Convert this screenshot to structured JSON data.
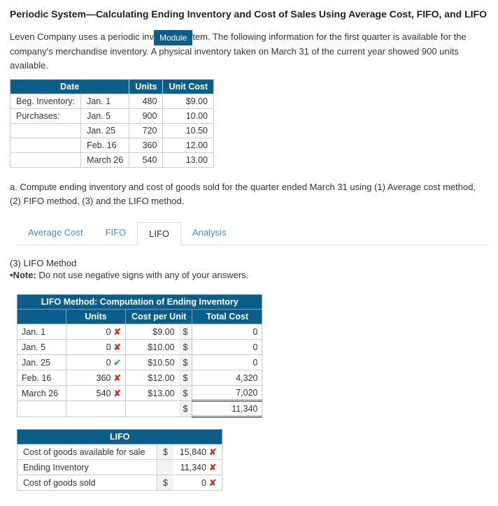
{
  "title": "Periodic System—Calculating Ending Inventory and Cost of Sales Using Average Cost, FIFO, and LIFO",
  "intro_before": "Leven Company uses a periodic inv",
  "module_label": "Module",
  "intro_after": "tem. The following information for the first quarter is available for the company's merchandise inventory. A physical inventory taken on March 31 of the current year showed 900 units available.",
  "inv_table": {
    "headers": {
      "date": "Date",
      "units": "Units",
      "unit_cost": "Unit Cost"
    },
    "rows": [
      {
        "label": "Beg. Inventory:",
        "date": "Jan. 1",
        "units": "480",
        "cost": "$9.00"
      },
      {
        "label": "Purchases:",
        "date": "Jan. 5",
        "units": "900",
        "cost": "10.00"
      },
      {
        "label": "",
        "date": "Jan. 25",
        "units": "720",
        "cost": "10.50"
      },
      {
        "label": "",
        "date": "Feb. 16",
        "units": "360",
        "cost": "12.00"
      },
      {
        "label": "",
        "date": "March 26",
        "units": "540",
        "cost": "13.00"
      }
    ]
  },
  "task_text": "a. Compute ending inventory and cost of goods sold for the quarter ended March 31 using (1) Average cost method, (2) FIFO method, (3) and the LIFO method.",
  "tabs": {
    "avg": "Average Cost",
    "fifo": "FIFO",
    "lifo": "LIFO",
    "analysis": "Analysis"
  },
  "section_head": "(3) LIFO Method",
  "note_label": "•Note:",
  "note_text": " Do not use negative signs with any of your answers.",
  "comp": {
    "title": "LIFO Method: Computation of Ending Inventory",
    "h_units": "Units",
    "h_cpu": "Cost per Unit",
    "h_total": "Total Cost",
    "rows": [
      {
        "date": "Jan. 1",
        "units": "0",
        "um": "✘",
        "uc": "wrong",
        "cpu": "$9.00",
        "cur": "$",
        "tc": "0"
      },
      {
        "date": "Jan. 5",
        "units": "0",
        "um": "✘",
        "uc": "wrong",
        "cpu": "$10.00",
        "cur": "$",
        "tc": "0"
      },
      {
        "date": "Jan. 25",
        "units": "0",
        "um": "✔",
        "uc": "right",
        "cpu": "$10.50",
        "cur": "$",
        "tc": "0"
      },
      {
        "date": "Feb. 16",
        "units": "360",
        "um": "✘",
        "uc": "wrong",
        "cpu": "$12.00",
        "cur": "$",
        "tc": "4,320"
      },
      {
        "date": "March 26",
        "units": "540",
        "um": "✘",
        "uc": "wrong",
        "cpu": "$13.00",
        "cur": "$",
        "tc": "7,020"
      }
    ],
    "total_cur": "$",
    "total_tc": "11,340"
  },
  "sum": {
    "title": "LIFO",
    "rows": [
      {
        "label": "Cost of goods available for sale",
        "cur": "$",
        "val": "15,840",
        "mark": "✘"
      },
      {
        "label": "Ending Inventory",
        "cur": "",
        "val": "11,340",
        "mark": "✘"
      },
      {
        "label": "Cost of goods sold",
        "cur": "$",
        "val": "0",
        "mark": "✘"
      }
    ]
  }
}
